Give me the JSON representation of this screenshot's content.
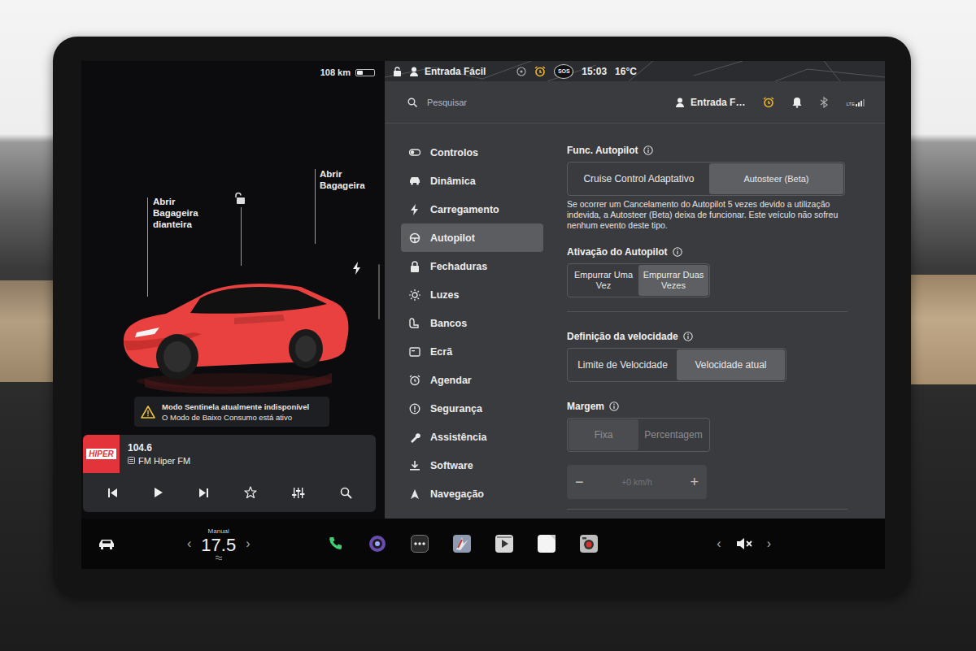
{
  "status_bar": {
    "range": "108 km",
    "battery_level": 0.35,
    "profile": "Entrada Fácil",
    "sos": "SOS",
    "time": "15:03",
    "temperature": "16°C"
  },
  "car": {
    "front_trunk": [
      "Abrir",
      "Bagageira",
      "dianteira"
    ],
    "trunk": [
      "Abrir",
      "Bagageira"
    ],
    "locked": false
  },
  "alert": {
    "title": "Modo Sentinela atualmente indisponível",
    "message": "O Modo de Baixo Consumo está ativo"
  },
  "media": {
    "logo": "HIPER",
    "frequency": "104.6",
    "station": "FM Hiper FM",
    "favorite": false
  },
  "settings_header": {
    "search_placeholder": "Pesquisar",
    "profile": "Entrada F…",
    "network": "LTE"
  },
  "sidebar": {
    "items": [
      {
        "label": "Controlos",
        "selected": false
      },
      {
        "label": "Dinâmica",
        "selected": false
      },
      {
        "label": "Carregamento",
        "selected": false
      },
      {
        "label": "Autopilot",
        "selected": true
      },
      {
        "label": "Fechaduras",
        "selected": false
      },
      {
        "label": "Luzes",
        "selected": false
      },
      {
        "label": "Bancos",
        "selected": false
      },
      {
        "label": "Ecrã",
        "selected": false
      },
      {
        "label": "Agendar",
        "selected": false
      },
      {
        "label": "Segurança",
        "selected": false
      },
      {
        "label": "Assistência",
        "selected": false
      },
      {
        "label": "Software",
        "selected": false
      },
      {
        "label": "Navegação",
        "selected": false
      }
    ]
  },
  "autopilot": {
    "sections": [
      {
        "title": "Func. Autopilot",
        "disabled": false,
        "options": [
          {
            "label": "Cruise Control Adaptativo",
            "selected": false
          },
          {
            "label": "Autosteer (Beta)",
            "selected": true
          }
        ],
        "note": "Se ocorrer um Cancelamento do Autopilot 5 vezes devido a utilização indevida, a Autosteer (Beta) deixa de funcionar. Este veículo não sofreu nenhum evento deste tipo."
      },
      {
        "title": "Ativação do Autopilot",
        "disabled": false,
        "options": [
          {
            "label": "Empurrar Uma Vez",
            "selected": false
          },
          {
            "label": "Empurrar Duas Vezes",
            "selected": true
          }
        ]
      },
      {
        "title": "Definição da velocidade",
        "disabled": false,
        "options": [
          {
            "label": "Limite de Velocidade",
            "selected": false
          },
          {
            "label": "Velocidade atual",
            "selected": true
          }
        ]
      },
      {
        "title": "Margem",
        "disabled": true,
        "options": [
          {
            "label": "Fixa",
            "selected": true
          },
          {
            "label": "Percentagem",
            "selected": false
          }
        ]
      }
    ],
    "stepper": {
      "minus": "−",
      "value": "+0 km/h",
      "plus": "+",
      "disabled": true
    }
  },
  "bottom_bar": {
    "climate_mode": "Manual",
    "temperature": "17.5",
    "temp_prev": "‹",
    "temp_next": "›",
    "volume_prev": "‹",
    "volume_next": "›",
    "muted": true
  }
}
